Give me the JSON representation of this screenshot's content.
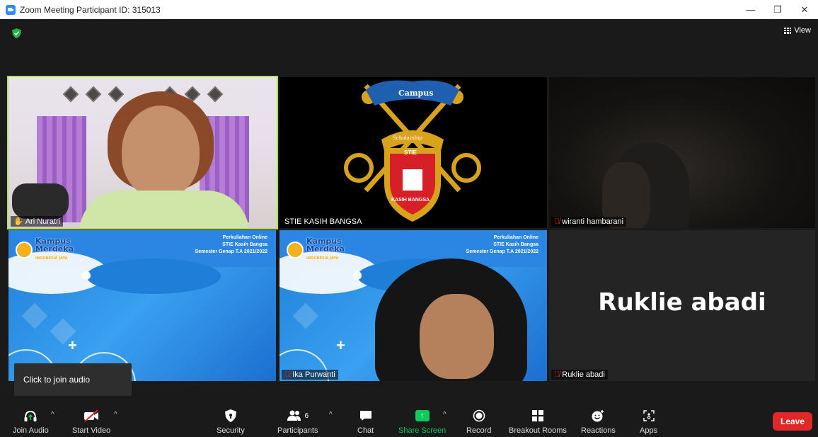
{
  "window": {
    "title": "Zoom Meeting Participant ID: 315013",
    "minimize": "—",
    "restore": "❐",
    "close": "✕"
  },
  "header": {
    "view_label": "View"
  },
  "participants": [
    {
      "name": "Ari Nuratri"
    },
    {
      "name": "STIE KASIH BANGSA"
    },
    {
      "name": "wiranti hambarani"
    },
    {
      "name": ""
    },
    {
      "name": "Ika Purwanti"
    },
    {
      "name": "Ruklie abadi"
    }
  ],
  "logo": {
    "banner": "Campus",
    "ribbon": "Scholarship",
    "shield_top": "STIE",
    "shield_words": "KASIH BANGSA"
  },
  "slide": {
    "brand_line1": "Kampus",
    "brand_line2": "Merdeka",
    "brand_sub": "INDONESIA JAYA",
    "title_line1": "Perkuliahan Online",
    "title_line2": "STIE Kasih Bangsa",
    "title_line3": "Semester Genap T.A 2021/2022"
  },
  "tooltip": "Click to join audio",
  "toolbar": {
    "join_audio": "Join Audio",
    "start_video": "Start Video",
    "security": "Security",
    "participants": "Participants",
    "participants_count": "6",
    "chat": "Chat",
    "share_screen": "Share Screen",
    "record": "Record",
    "breakout_rooms": "Breakout Rooms",
    "reactions": "Reactions",
    "apps": "Apps",
    "leave": "Leave"
  },
  "colors": {
    "active_speaker_border": "#b4e05a",
    "share_green": "#11c85b",
    "leave_red": "#e02828",
    "slide_blue": "#1f7fd8"
  }
}
